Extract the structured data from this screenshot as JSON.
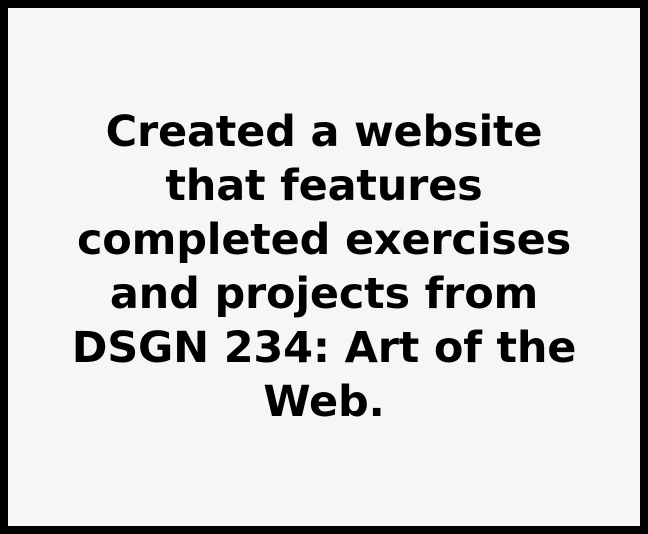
{
  "card": {
    "description": "Created a website that features completed exercises and projects from DSGN 234: Art of the Web."
  },
  "colors": {
    "border": "#000000",
    "background": "#f6f6f6",
    "text": "#000000"
  }
}
